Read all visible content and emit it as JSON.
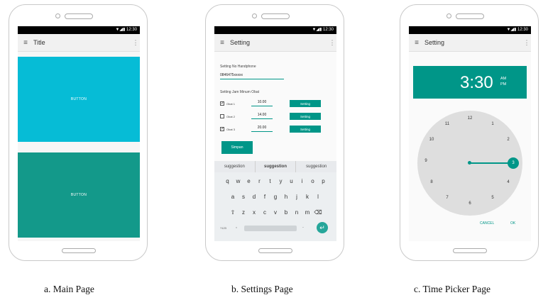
{
  "phones": [
    {
      "status_time": "12:30",
      "title": "Title",
      "button_top": "BUTTON",
      "button_bottom": "BUTTON",
      "colors": {
        "top": "#06bcd6",
        "bottom": "#13998a"
      }
    },
    {
      "status_time": "12:30",
      "title": "Setting",
      "phone_label": "Setting No Handphone",
      "phone_value": "0846475xxxxx",
      "schedule_label": "Setting Jam Minum Obat",
      "rows": [
        {
          "checked": true,
          "name": "Obat 1",
          "time": "10.00",
          "button": "Setting"
        },
        {
          "checked": false,
          "name": "Obat 2",
          "time": "14.00",
          "button": "Setting"
        },
        {
          "checked": true,
          "name": "Obat 3",
          "time": "20.00",
          "button": "Setting"
        }
      ],
      "save_button": "Simpan",
      "suggestions": [
        "suggestion",
        "suggestion",
        "suggestion"
      ],
      "keyboard": {
        "row1": [
          "q",
          "w",
          "e",
          "r",
          "t",
          "y",
          "u",
          "i",
          "o",
          "p"
        ],
        "row2": [
          "a",
          "s",
          "d",
          "f",
          "g",
          "h",
          "j",
          "k",
          "l"
        ],
        "row3": [
          "⇧",
          "z",
          "x",
          "c",
          "v",
          "b",
          "n",
          "m",
          "⌫"
        ],
        "symbols": "?123",
        "comma": ",",
        "period": "."
      }
    },
    {
      "status_time": "12:30",
      "title": "Setting",
      "time": "3:30",
      "am": "AM",
      "pm": "PM",
      "dial_numbers": [
        "12",
        "1",
        "2",
        "3",
        "4",
        "5",
        "6",
        "7",
        "8",
        "9",
        "10",
        "11"
      ],
      "cancel": "CANCEL",
      "ok": "OK"
    }
  ],
  "captions": [
    "a. Main Page",
    "b. Settings Page",
    "c. Time Picker Page"
  ]
}
